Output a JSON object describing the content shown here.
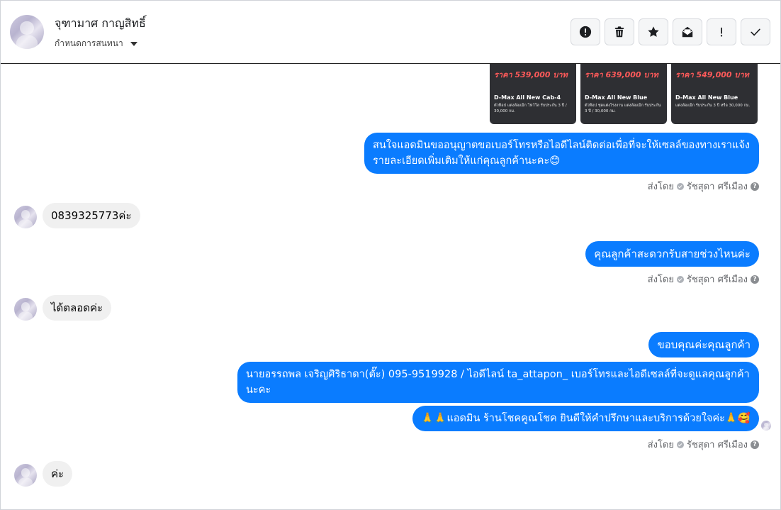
{
  "header": {
    "contact_name": "จุฑามาศ กาญสิทธิ์",
    "conversation_setting": "กำหนดการสนทนา",
    "toolbar": [
      {
        "name": "spam-button",
        "icon": "alert-circle-icon"
      },
      {
        "name": "delete-button",
        "icon": "trash-icon"
      },
      {
        "name": "star-button",
        "icon": "star-icon"
      },
      {
        "name": "mark-unread-button",
        "icon": "envelope-open-icon"
      },
      {
        "name": "important-button",
        "icon": "exclamation-icon"
      },
      {
        "name": "done-button",
        "icon": "check-icon"
      }
    ]
  },
  "cards": [
    {
      "price": "ราคา 539,000 บาท",
      "model": "D-Max All New Cab-4",
      "desc": "ตัวท็อป แต่งล้อแม็ก โฟว์วีล รับประกัน 3 ปี / 30,000 กม."
    },
    {
      "price": "ราคา 639,000 บาท",
      "model": "D-Max All New Blue",
      "desc": "ตัวท็อป ชุดแต่งโรงงาน แต่งล้อแม็ก รับประกัน 3 ปี / 30,000 กม."
    },
    {
      "price": "ราคา 549,000 บาท",
      "model": "D-Max All New Blue",
      "desc": "แต่งล้อแม็ก รับประกัน 3 ปี หรือ 30,000 กม."
    }
  ],
  "messages": {
    "m1": "สนใจแอดมินขออนุญาตขอเบอร์โทรหรือไอดีไลน์ติดต่อเพื่อที่จะให้เซลล์ของทางเราแจ้งรายละเอียดเพิ่มเติมให้แก่คุณลูกค้านะคะ😊",
    "m2": "0839325773ค่ะ",
    "m3": "คุณลูกค้าสะดวกรับสายช่วงไหนค่ะ",
    "m4": "ได้ตลอดค่ะ",
    "m5": "ขอบคุณค่ะคุณลูกค้า",
    "m6": "นายอรรถพล เจริญศิริธาดา(ตั๊ะ)      095-9519928 / ไอดีไลน์ ta_attapon_  เบอร์โทรและไอดีเซลล์ที่จะดูแลคุณลูกค้านะคะ",
    "m7": "🙏🙏แอดมิน ร้านโชคคูณโชค ยินดีให้คำปรึกษาและบริการด้วยใจค่ะ🙏🥰",
    "m8": "ค่ะ"
  },
  "sent_by": {
    "prefix": "ส่งโดย",
    "agent": "รัชสุดา ศรีเมือง",
    "help": "?"
  },
  "colors": {
    "outgoing_bubble": "#0a7cff",
    "incoming_bubble": "#f0f0f0"
  }
}
